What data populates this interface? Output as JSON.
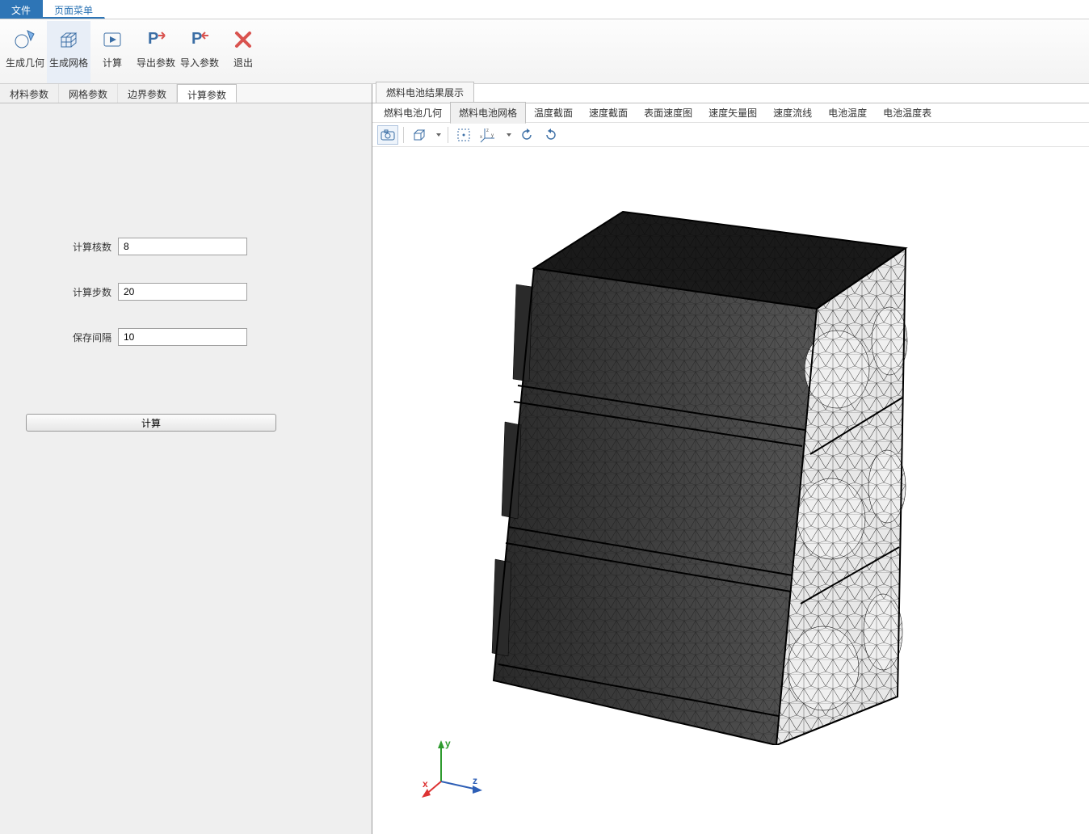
{
  "menubar": {
    "file": "文件",
    "page_menu": "页面菜单"
  },
  "ribbon": {
    "generate_geometry": "生成几何",
    "generate_mesh": "生成网格",
    "compute": "计算",
    "export_params": "导出参数",
    "import_params": "导入参数",
    "exit": "退出"
  },
  "left_tabs": {
    "material": "材料参数",
    "mesh": "网格参数",
    "boundary": "边界参数",
    "compute": "计算参数"
  },
  "params": {
    "cores_label": "计算核数",
    "cores_value": "8",
    "steps_label": "计算步数",
    "steps_value": "20",
    "save_interval_label": "保存间隔",
    "save_interval_value": "10"
  },
  "compute_button": "计算",
  "right_top_tab": "燃料电池结果展示",
  "sub_tabs": {
    "geometry": "燃料电池几何",
    "mesh": "燃料电池网格",
    "temp_section": "温度截面",
    "velocity_section": "速度截面",
    "surface_velocity": "表面速度图",
    "velocity_vector": "速度矢量图",
    "velocity_streamline": "速度流线",
    "battery_temp": "电池温度",
    "battery_temp_table": "电池温度表"
  },
  "axes": {
    "x": "x",
    "y": "y",
    "z": "z"
  }
}
